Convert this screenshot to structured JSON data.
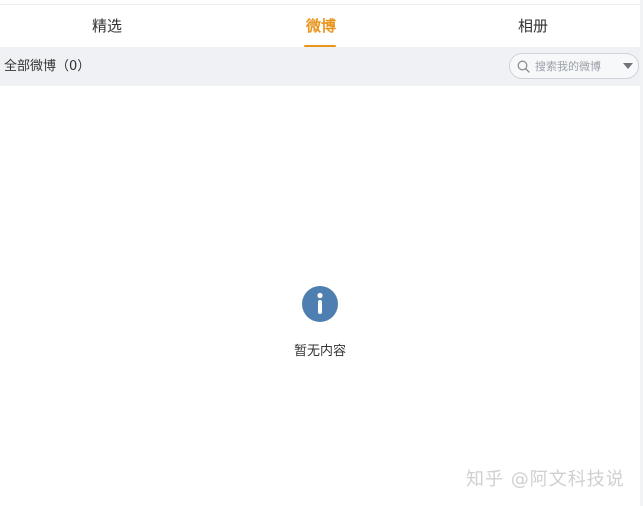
{
  "tabs": {
    "items": [
      {
        "label": "精选"
      },
      {
        "label": "微博"
      },
      {
        "label": "相册"
      }
    ],
    "active_index": 1,
    "active_color": "#e9961f"
  },
  "filter": {
    "title": "全部微博（0）",
    "search_placeholder": "搜索我的微博"
  },
  "empty_state": {
    "icon": "info-icon",
    "icon_color": "#4f7fb0",
    "message": "暂无内容"
  },
  "watermark": {
    "text": "知乎 @阿文科技说"
  }
}
